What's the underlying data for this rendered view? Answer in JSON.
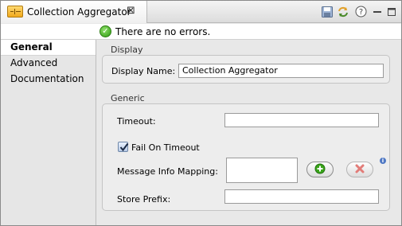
{
  "tab": {
    "title": "Collection Aggregator",
    "icon": "collection-aggregator-icon",
    "close_icon": "close-icon"
  },
  "toolbar": {
    "icons": [
      "save-icon",
      "sync-icon",
      "help-icon",
      "minimize-icon",
      "maximize-icon"
    ]
  },
  "status": {
    "text": "There are no errors.",
    "icon": "check-circle-icon",
    "color": "#2f9a12"
  },
  "sidebar": {
    "items": [
      {
        "label": "General",
        "active": true
      },
      {
        "label": "Advanced",
        "active": false
      },
      {
        "label": "Documentation",
        "active": false
      }
    ]
  },
  "display": {
    "section_title": "Display",
    "display_name_label": "Display Name:",
    "display_name_value": "Collection Aggregator"
  },
  "generic": {
    "section_title": "Generic",
    "timeout_label": "Timeout:",
    "timeout_value": "",
    "fail_on_timeout_label": "Fail On Timeout",
    "fail_on_timeout_checked": true,
    "message_info_mapping_label": "Message Info Mapping:",
    "message_info_mapping_value": "",
    "add_icon": "plus-icon",
    "remove_icon": "remove-icon",
    "info_icon": "info-icon",
    "store_prefix_label": "Store Prefix:",
    "store_prefix_value": ""
  },
  "colors": {
    "add_green": "#3aa51a",
    "remove_red": "#d9534f",
    "accent_blue": "#4f78c4"
  }
}
